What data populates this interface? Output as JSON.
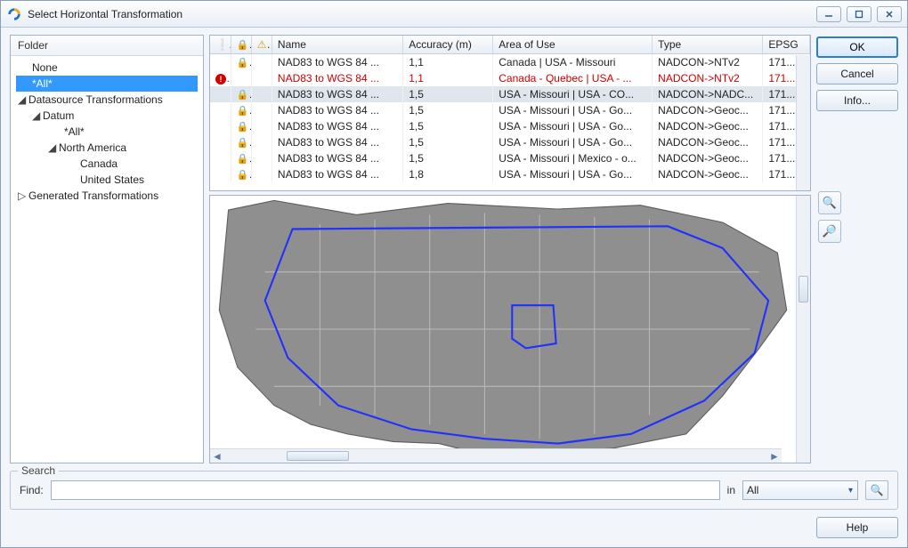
{
  "window": {
    "title": "Select Horizontal Transformation"
  },
  "folder": {
    "header": "Folder",
    "items": {
      "none": "None",
      "all": "*All*",
      "ds_transforms": "Datasource Transformations",
      "datum": "Datum",
      "datum_all": "*All*",
      "north_america": "North America",
      "canada": "Canada",
      "usa": "United States",
      "gen_transforms": "Generated Transformations"
    }
  },
  "table": {
    "headers": {
      "alert": "",
      "lock": "",
      "warn": "",
      "name": "Name",
      "accuracy": "Accuracy (m)",
      "area": "Area of Use",
      "type": "Type",
      "epsg": "EPSG"
    },
    "rows": [
      {
        "alert": false,
        "lock": true,
        "name": "NAD83 to WGS 84 ...",
        "accuracy": "1,1",
        "area": "Canada | USA - Missouri",
        "type": "NADCON->NTv2",
        "epsg": "171...",
        "red": false,
        "selected": false
      },
      {
        "alert": true,
        "lock": false,
        "name": "NAD83 to WGS 84 ...",
        "accuracy": "1,1",
        "area": "Canada - Quebec | USA - ...",
        "type": "NADCON->NTv2",
        "epsg": "171...",
        "red": true,
        "selected": false
      },
      {
        "alert": false,
        "lock": true,
        "name": "NAD83 to WGS 84 ...",
        "accuracy": "1,5",
        "area": "USA - Missouri | USA - CO...",
        "type": "NADCON->NADC...",
        "epsg": "171...",
        "red": false,
        "selected": true
      },
      {
        "alert": false,
        "lock": true,
        "name": "NAD83 to WGS 84 ...",
        "accuracy": "1,5",
        "area": "USA - Missouri | USA - Go...",
        "type": "NADCON->Geoc...",
        "epsg": "171...",
        "red": false,
        "selected": false
      },
      {
        "alert": false,
        "lock": true,
        "name": "NAD83 to WGS 84 ...",
        "accuracy": "1,5",
        "area": "USA - Missouri | USA - Go...",
        "type": "NADCON->Geoc...",
        "epsg": "171...",
        "red": false,
        "selected": false
      },
      {
        "alert": false,
        "lock": true,
        "name": "NAD83 to WGS 84 ...",
        "accuracy": "1,5",
        "area": "USA - Missouri | USA - Go...",
        "type": "NADCON->Geoc...",
        "epsg": "171...",
        "red": false,
        "selected": false
      },
      {
        "alert": false,
        "lock": true,
        "name": "NAD83 to WGS 84 ...",
        "accuracy": "1,5",
        "area": "USA - Missouri | Mexico - o...",
        "type": "NADCON->Geoc...",
        "epsg": "171...",
        "red": false,
        "selected": false
      },
      {
        "alert": false,
        "lock": true,
        "name": "NAD83 to WGS 84 ...",
        "accuracy": "1,8",
        "area": "USA - Missouri | USA - Go...",
        "type": "NADCON->Geoc...",
        "epsg": "171...",
        "red": false,
        "selected": false
      }
    ]
  },
  "buttons": {
    "ok": "OK",
    "cancel": "Cancel",
    "info": "Info...",
    "help": "Help"
  },
  "search": {
    "legend": "Search",
    "find_label": "Find:",
    "find_value": "",
    "in_label": "in",
    "scope": "All"
  }
}
